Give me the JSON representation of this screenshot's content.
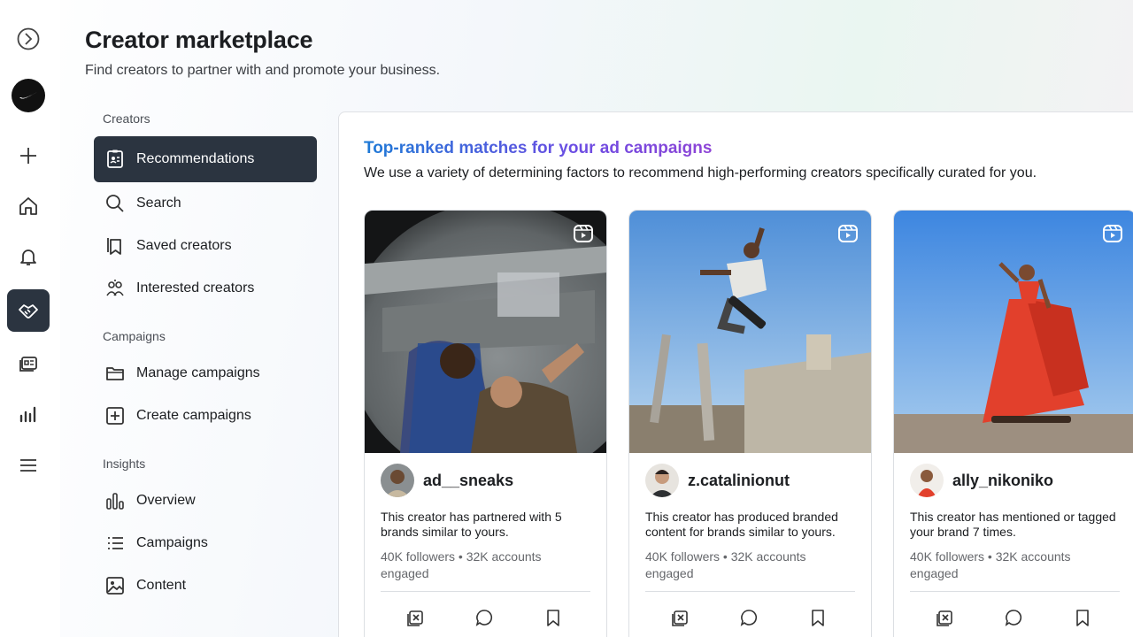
{
  "header": {
    "title": "Creator marketplace",
    "subtitle": "Find creators to partner with and promote your business."
  },
  "rail": {
    "items": [
      "meta-logo-icon",
      "nike-avatar",
      "plus-icon",
      "home-icon",
      "bell-icon",
      "handshake-icon",
      "ads-icon",
      "insights-icon",
      "menu-icon"
    ],
    "active": "handshake-icon"
  },
  "subnav": {
    "creators_label": "Creators",
    "creators_items": [
      {
        "label": "Recommendations",
        "icon": "badge-icon"
      },
      {
        "label": "Search",
        "icon": "search-icon"
      },
      {
        "label": "Saved creators",
        "icon": "saved-icon"
      },
      {
        "label": "Interested creators",
        "icon": "people-icon"
      }
    ],
    "campaigns_label": "Campaigns",
    "campaigns_items": [
      {
        "label": "Manage campaigns",
        "icon": "folder-icon"
      },
      {
        "label": "Create campaigns",
        "icon": "plus-square-icon"
      }
    ],
    "insights_label": "Insights",
    "insights_items": [
      {
        "label": "Overview",
        "icon": "bar-chart-icon"
      },
      {
        "label": "Campaigns",
        "icon": "list-icon"
      },
      {
        "label": "Content",
        "icon": "image-icon"
      }
    ]
  },
  "panel": {
    "title": "Top-ranked matches for your ad campaigns",
    "description": "We use a variety of determining factors to recommend high-performing creators specifically curated for you."
  },
  "cards": [
    {
      "handle": "ad__sneaks",
      "reason": "This creator has partnered with 5 brands similar to yours.",
      "stats": "40K followers • 32K accounts engaged"
    },
    {
      "handle": "z.catalinionut",
      "reason": "This creator has produced branded content for brands similar to yours.",
      "stats": "40K followers • 32K accounts engaged"
    },
    {
      "handle": "ally_nikoniko",
      "reason": "This creator has mentioned or tagged your brand 7 times.",
      "stats": "40K followers • 32K accounts engaged"
    }
  ],
  "colors": {
    "active_bg": "#2b3440",
    "title_gradient_start": "#1d7ad6",
    "title_gradient_end": "#8e44d6"
  }
}
